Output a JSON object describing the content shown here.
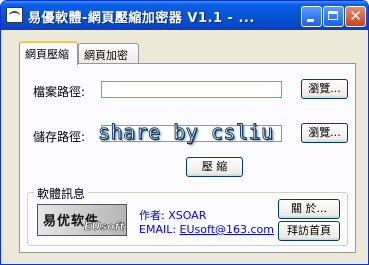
{
  "window": {
    "title": "易優軟體-網頁壓縮加密器 V1.1 - ...",
    "icon": "app-wave-icon"
  },
  "tabs": [
    {
      "label": "網頁壓縮",
      "active": true
    },
    {
      "label": "網頁加密",
      "active": false
    }
  ],
  "form": {
    "file_path_label": "檔案路徑:",
    "file_path_value": "",
    "save_path_label": "儲存路徑:",
    "save_path_value": "",
    "browse_label": "瀏覽...",
    "compress_label": "壓 縮"
  },
  "watermark": "share by csliu",
  "info": {
    "group_title": "軟體訊息",
    "logo_cn": "易优软件",
    "logo_en": "EUsoft",
    "author_line": "作者: XSOAR",
    "email_prefix": "EMAIL: ",
    "email_link": "EUsoft@163.com",
    "about_label": "關 於...",
    "homepage_label": "拜訪首頁"
  },
  "colors": {
    "titlebar": "#0653d6",
    "window_bg": "#ece9d8",
    "link": "#0000ff"
  }
}
